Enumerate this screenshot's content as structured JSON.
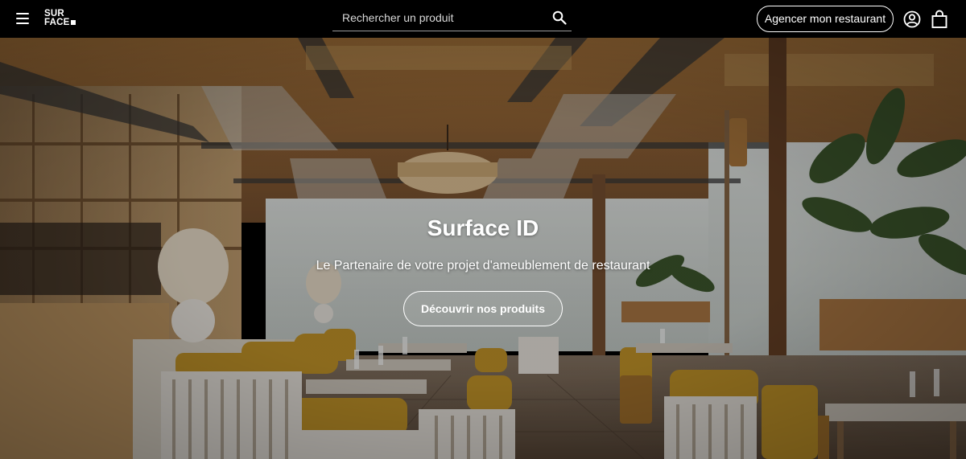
{
  "header": {
    "logo_line1": "SUR",
    "logo_line2": "FACE",
    "search_placeholder": "Rechercher un produit",
    "cta_label": "Agencer mon restaurant",
    "menu_icon": "hamburger-menu-icon",
    "search_icon": "search-icon",
    "account_icon": "user-account-icon",
    "cart_icon": "shopping-bag-icon"
  },
  "hero": {
    "title": "Surface ID",
    "subtitle": "Le Partenaire de votre projet d'ameublement de restaurant",
    "cta_label": "Découvrir nos produits"
  },
  "colors": {
    "header_bg": "#000000",
    "text": "#ffffff",
    "mustard": "#c8992a",
    "wood": "#8a5a2b",
    "ceiling": "#b8844a"
  }
}
